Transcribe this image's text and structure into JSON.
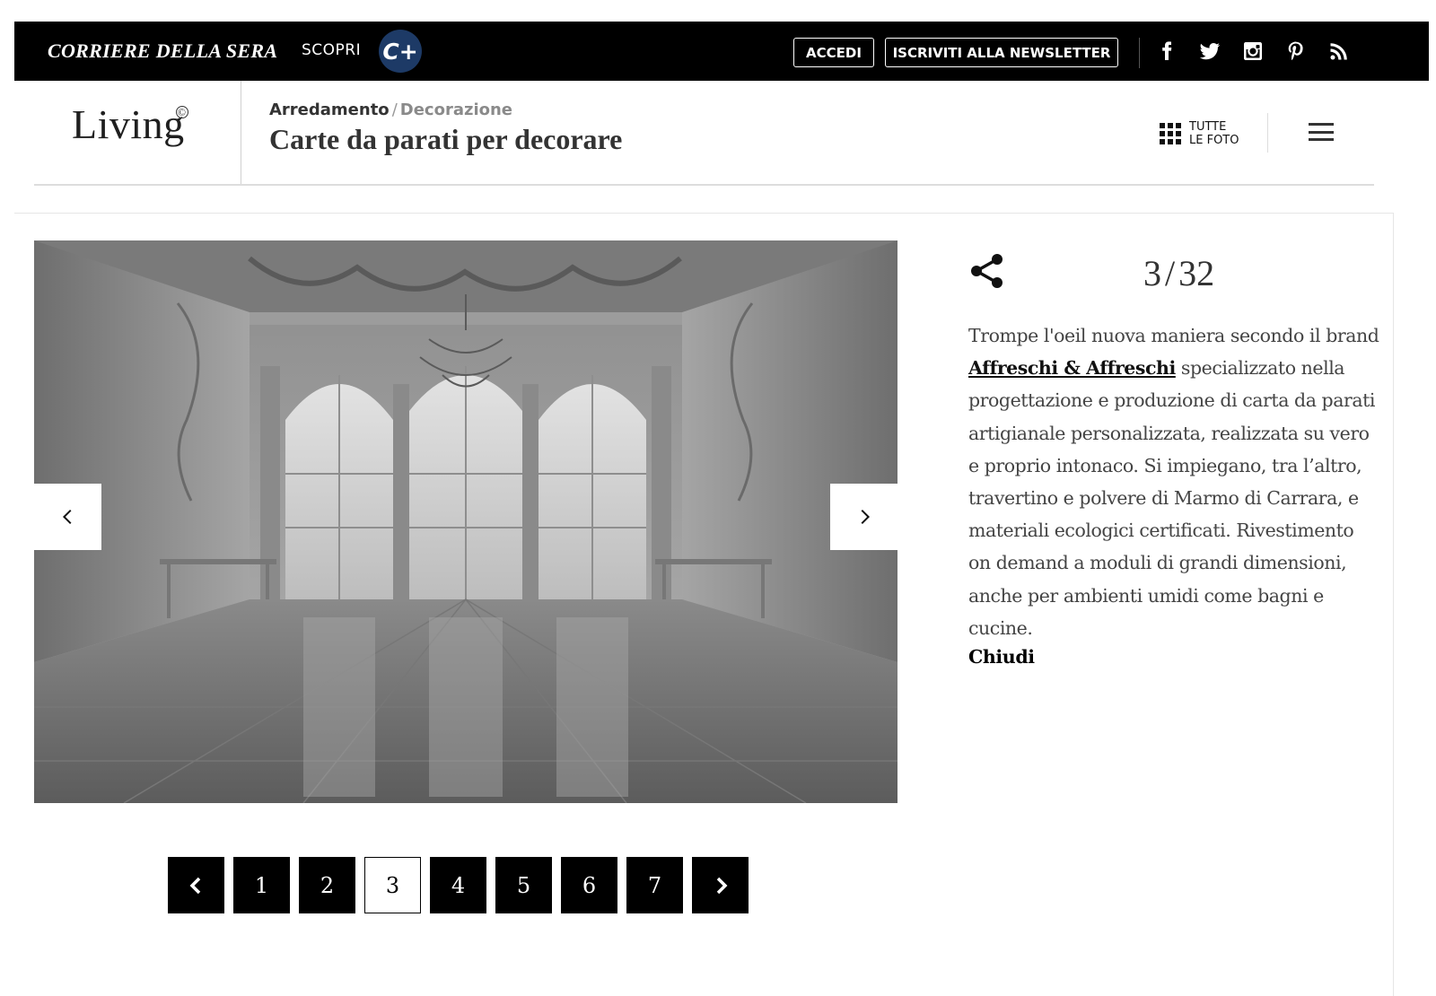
{
  "topbar": {
    "brand": "CORRIERE DELLA SERA",
    "scopri": "SCOPRI",
    "cplus": "C+",
    "login": "ACCEDI",
    "newsletter": "ISCRIVITI ALLA NEWSLETTER",
    "social": [
      "facebook-icon",
      "twitter-icon",
      "instagram-icon",
      "pinterest-icon",
      "rss-icon"
    ]
  },
  "header": {
    "logo": "Living",
    "logo_reg": "©",
    "breadcrumb": {
      "category": "Arredamento",
      "separator": "/",
      "subcategory": "Decorazione"
    },
    "title": "Carte da parati per decorare",
    "all_photos_line1": "TUTTE",
    "all_photos_line2": "LE FOTO"
  },
  "gallery": {
    "current": "3",
    "total": "32",
    "separator": "/",
    "caption_before": "Trompe l'oeil nuova maniera secondo il brand ",
    "caption_link": "Affreschi & Affreschi",
    "caption_after": " specializzato nella progettazione e produzione di carta da parati artigianale personalizzata, realizzata su vero e proprio intonaco. Si impiegano, tra l’altro, travertino e polvere di Marmo di Carrara, e materiali ecologici certificati. Rivestimento on demand a moduli di grandi dimensioni, anche per ambienti umidi come bagni e cucine.",
    "close_label": "Chiudi"
  },
  "pagination": {
    "pages": [
      "1",
      "2",
      "3",
      "4",
      "5",
      "6",
      "7"
    ],
    "active": "3"
  },
  "colors": {
    "topbar": "#000000",
    "cplus_badge": "#1d3a66"
  }
}
